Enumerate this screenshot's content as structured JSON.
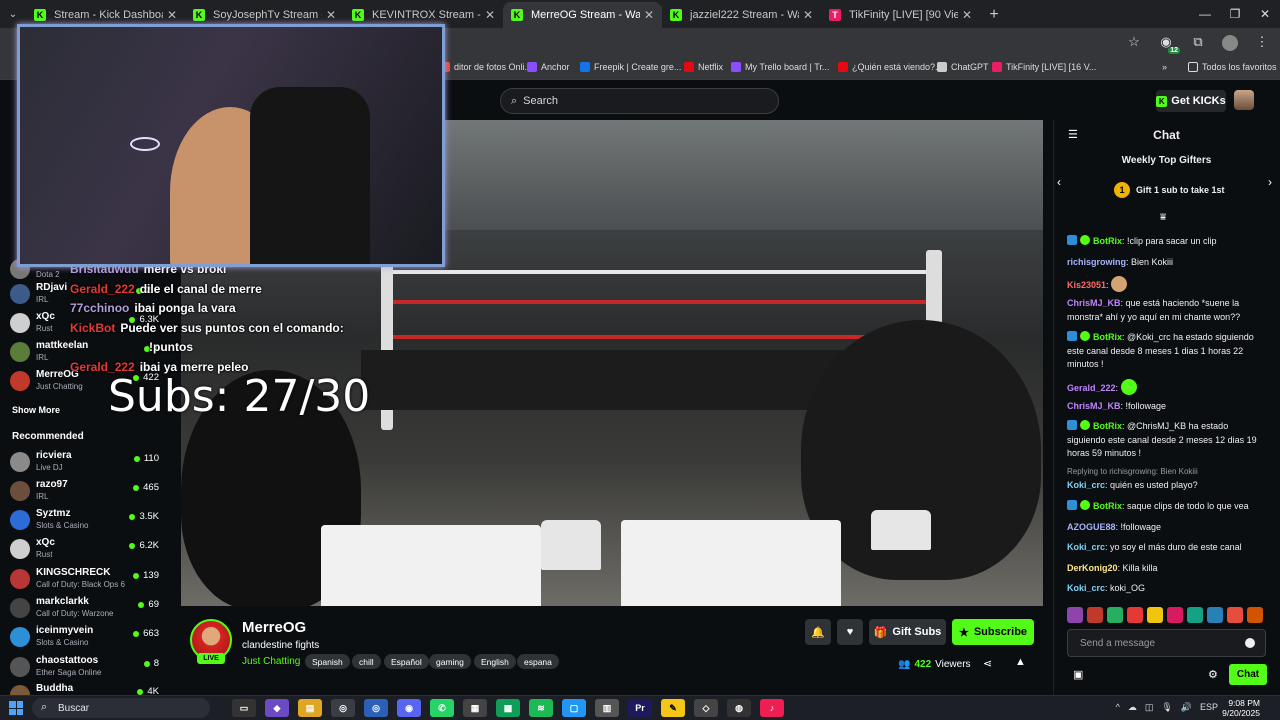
{
  "browser": {
    "tabs": [
      {
        "label": "Stream - Kick Dashboard",
        "active": false,
        "favicon": "kick-icon"
      },
      {
        "label": "SoyJosephTv Stream - Watch Li",
        "active": false,
        "favicon": "kick-icon"
      },
      {
        "label": "KEVINTROX Stream - Watch Live",
        "active": false,
        "favicon": "kick-icon"
      },
      {
        "label": "MerreOG Stream - Watch Live o",
        "active": true,
        "favicon": "kick-icon"
      },
      {
        "label": "jazziel222 Stream - Watch Live",
        "active": false,
        "favicon": "kick-icon"
      },
      {
        "label": "TikFinity [LIVE] [90 Viewers]",
        "active": false,
        "favicon": "tikfinity-icon"
      }
    ],
    "profile_badge": "12",
    "bookmarks": [
      {
        "label": "ditor de fotos Onli...",
        "color": "#e94335"
      },
      {
        "label": "Anchor",
        "color": "#8a4dff"
      },
      {
        "label": "Freepik | Create gre...",
        "color": "#1273eb"
      },
      {
        "label": "Netflix",
        "color": "#e50914"
      },
      {
        "label": "My Trello board | Tr...",
        "color": "#8a4dff"
      },
      {
        "label": "¿Quién está viendo?...",
        "color": "#e50914"
      },
      {
        "label": "ChatGPT",
        "color": "#cccccc"
      },
      {
        "label": "TikFinity [LIVE] [16 V...",
        "color": "#e91e63"
      }
    ],
    "bookmarks_all": "Todos los favoritos"
  },
  "header": {
    "search_placeholder": "Search",
    "get_kicks": "Get KICKs"
  },
  "sidebar": {
    "following_partial": [
      {
        "name": "",
        "category": "Dota 2",
        "viewers": "",
        "color": "#777"
      },
      {
        "name": "RDjavi",
        "category": "IRL",
        "viewers": "2.0",
        "color": "#3c5a8a"
      },
      {
        "name": "xQc",
        "category": "Rust",
        "viewers": "6.3K",
        "color": "#cfcfcf"
      },
      {
        "name": "mattkeelan",
        "category": "IRL",
        "viewers": "1",
        "color": "#5a7d3a"
      },
      {
        "name": "MerreOG",
        "category": "Just Chatting",
        "viewers": "422",
        "color": "#c0392b"
      }
    ],
    "show_more": "Show More",
    "recommended_title": "Recommended",
    "recommended": [
      {
        "name": "ricviera",
        "category": "Live DJ",
        "viewers": "110",
        "color": "#8a8a8a"
      },
      {
        "name": "razo97",
        "category": "IRL",
        "viewers": "465",
        "color": "#6b4e3c"
      },
      {
        "name": "Syztmz",
        "category": "Slots & Casino",
        "viewers": "3.5K",
        "color": "#2d6bd6"
      },
      {
        "name": "xQc",
        "category": "Rust",
        "viewers": "6.2K",
        "color": "#cfcfcf"
      },
      {
        "name": "KINGSCHRECK",
        "category": "Call of Duty: Black Ops 6",
        "viewers": "139",
        "color": "#b73636"
      },
      {
        "name": "markclarkk",
        "category": "Call of Duty: Warzone",
        "viewers": "69",
        "color": "#444"
      },
      {
        "name": "iceinmyvein",
        "category": "Slots & Casino",
        "viewers": "663",
        "color": "#2d8fd6"
      },
      {
        "name": "chaostattoos",
        "category": "Ether Saga Online",
        "viewers": "8",
        "color": "#555"
      },
      {
        "name": "Buddha",
        "category": "",
        "viewers": "4K",
        "color": "#7a5a3a"
      }
    ]
  },
  "overlay": {
    "subs": "Subs: 27/30",
    "chat": [
      {
        "user": "Brisitauwuu",
        "user_color": "#b39ddb",
        "text": "merre vs broki"
      },
      {
        "user": "Gerald_222",
        "user_color": "#e53935",
        "text": "dile el canal de merre"
      },
      {
        "user": "77cchinoo",
        "user_color": "#b39ddb",
        "text": "ibai ponga la vara"
      },
      {
        "user": "KickBot",
        "user_color": "#e53935",
        "text": "Puede ver sus puntos con el comando:"
      },
      {
        "user": "",
        "user_color": "#e53935",
        "text": "!puntos"
      },
      {
        "user": "Gerald_222",
        "user_color": "#e53935",
        "text": "ibai ya merre peleo"
      }
    ]
  },
  "stream": {
    "channel": "MerreOG",
    "live_badge": "LIVE",
    "title": "clandestine fights",
    "category": "Just Chatting",
    "tags": [
      "Spanish",
      "chill",
      "Español",
      "gaming",
      "English",
      "espana"
    ],
    "gift_subs": "Gift Subs",
    "subscribe": "Subscribe",
    "viewers": "422",
    "viewers_label": "Viewers"
  },
  "chat": {
    "title": "Chat",
    "top_gifters": "Weekly Top Gifters",
    "gift_prompt": "Gift 1 sub to take 1st",
    "gift_rank": "1",
    "messages": [
      {
        "user": "BotRix",
        "color": "#53fc18",
        "badges": true,
        "text": "!clip para sacar un clip"
      },
      {
        "user": "richisgrowing",
        "color": "#a5b4fc",
        "badges": false,
        "text": "Bien Kokiii"
      },
      {
        "user": "Kis23051",
        "color": "#ff6b6b",
        "badges": false,
        "text": ""
      },
      {
        "user": "ChrisMJ_KB",
        "color": "#c084fc",
        "badges": false,
        "text": "que está haciendo *suene la monstra* ahí y yo aquí en mi chante won??"
      },
      {
        "user": "BotRix",
        "color": "#53fc18",
        "badges": true,
        "text": "@Koki_crc ha estado siguiendo este canal desde 8 meses 1 dias 1 horas 22 minutos !"
      },
      {
        "user": "Gerald_222",
        "color": "#c084fc",
        "badges": false,
        "text": ""
      },
      {
        "user": "ChrisMJ_KB",
        "color": "#c084fc",
        "badges": false,
        "text": "!followage"
      },
      {
        "user": "BotRix",
        "color": "#53fc18",
        "badges": true,
        "text": "@ChrisMJ_KB ha estado siguiendo este canal desde 2 meses 12 dias 19 horas 59 minutos !"
      },
      {
        "user": "Koki_crc",
        "color": "#7dd3fc",
        "badges": false,
        "text": "quién es usted playo?"
      },
      {
        "user": "BotRix",
        "color": "#53fc18",
        "badges": true,
        "text": "saque clips de todo lo que vea"
      },
      {
        "user": "AZOGUE88",
        "color": "#a5b4fc",
        "badges": false,
        "text": "!followage"
      },
      {
        "user": "Koki_crc",
        "color": "#7dd3fc",
        "badges": false,
        "text": "yo soy el más duro de este canal"
      },
      {
        "user": "DerKonig20",
        "color": "#fde68a",
        "badges": false,
        "text": "Killa killa"
      },
      {
        "user": "Koki_crc",
        "color": "#7dd3fc",
        "badges": false,
        "text": "koki_OG"
      }
    ],
    "reply_to": "Replying to richisgrowing: Bien Kokiii",
    "input_placeholder": "Send a message",
    "send_label": "Chat"
  },
  "taskbar": {
    "search": "Buscar",
    "lang": "ESP",
    "time": "9:08 PM",
    "date": "9/20/2025"
  }
}
